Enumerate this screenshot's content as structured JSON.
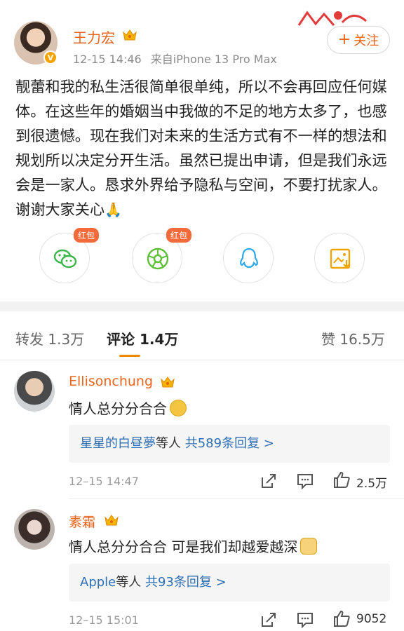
{
  "post": {
    "author": "王力宏",
    "time": "12-15 14:46",
    "source": "来自iPhone 13 Pro Max",
    "follow_label": "关注",
    "content": "靓蕾和我的私生活很简单很单纯，所以不会再回应任何媒体。在这些年的婚姻当中我做的不足的地方太多了，也感到很遗憾。现在我们对未来的生活方式有不一样的想法和规划所以决定分开生活。虽然已提出申请，但是我们永远会是一家人。恳求外界给予隐私与空间，不要打扰家人。谢谢大家关心",
    "content_emoji": "🙏"
  },
  "share": {
    "items": [
      {
        "icon": "wechat-icon",
        "tag": "红包"
      },
      {
        "icon": "moments-icon",
        "tag": "红包"
      },
      {
        "icon": "qq-icon",
        "tag": ""
      },
      {
        "icon": "save-image-icon",
        "tag": ""
      }
    ]
  },
  "tabs": {
    "repost": "转发 1.3万",
    "comments": "评论 1.4万",
    "likes": "赞 16.5万"
  },
  "comments": [
    {
      "name": "Ellisonchung",
      "text": "情人总分分合合",
      "reply_user": "星星的白昼夢",
      "reply_mid": "等人",
      "reply_count": "共589条回复 >",
      "time": "12–15 14:47",
      "likes": "2.5万"
    },
    {
      "name": "素霜",
      "text": "情人总分分合合 可是我们却越爱越深",
      "reply_user": "Apple",
      "reply_mid": "等人",
      "reply_count": "共93条回复 >",
      "time": "12–15 15:01",
      "likes": "9052"
    }
  ],
  "colors": {
    "accent": "#e8641b",
    "link": "#2f6fb5",
    "tab_indicator": "#f08a00",
    "redpacket": "#f56a3a"
  }
}
